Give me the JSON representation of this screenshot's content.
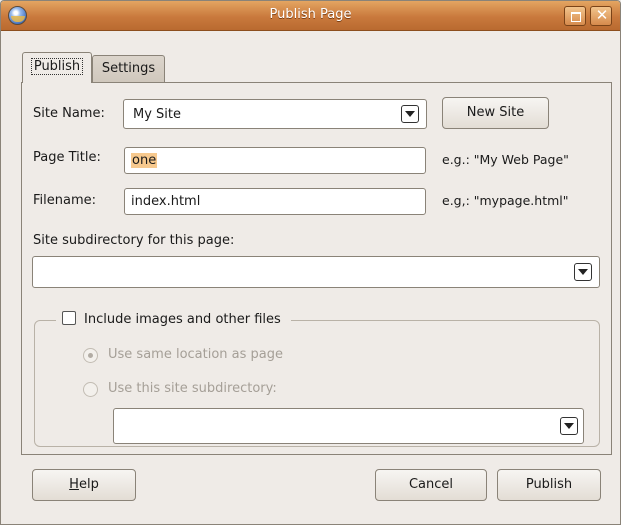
{
  "window": {
    "title": "Publish Page"
  },
  "tabs": [
    {
      "label": "Publish"
    },
    {
      "label": "Settings"
    }
  ],
  "publish": {
    "site_name_label": "Site Name:",
    "site_name_value": "My Site",
    "new_site_label": "New Site",
    "page_title_label": "Page Title:",
    "page_title_value": "one",
    "page_title_hint": "e.g.: \"My Web Page\"",
    "filename_label": "Filename:",
    "filename_value": "index.html",
    "filename_hint": "e.g,: \"mypage.html\"",
    "subdir_label": "Site subdirectory for this page:",
    "subdir_value": "",
    "include_label": "Include images and other files",
    "include_checked": false,
    "same_location_label": "Use same location as page",
    "same_location_selected": true,
    "use_subdir_label": "Use this site subdirectory:",
    "files_subdir_value": ""
  },
  "footer": {
    "help_label_underlined": "H",
    "help_label_rest": "elp",
    "cancel_label": "Cancel",
    "publish_label": "Publish"
  }
}
